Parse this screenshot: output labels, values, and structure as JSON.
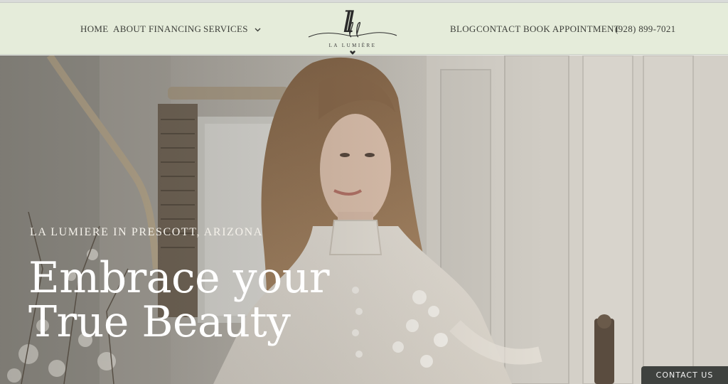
{
  "nav": {
    "home": "HOME",
    "about": "ABOUT",
    "financing": "FINANCING",
    "services": "SERVICES",
    "blog": "BLOG",
    "contact": "CONTACT",
    "book": "BOOK APPOINTMENT",
    "phone": "(928) 899-7021"
  },
  "logo": {
    "monogram": "ll",
    "name": "LA LUMIÈRE"
  },
  "hero": {
    "eyebrow": "LA LUMIERE IN PRESCOTT, ARIZONA",
    "headline_line1": "Embrace your",
    "headline_line2": "True Beauty"
  },
  "contact_tab": {
    "label": "CONTACT US"
  },
  "icons": {
    "services_dropdown": "chevron-down-icon",
    "logo_ornament": "heart-icon"
  },
  "colors": {
    "nav_bg": "#e5ecda",
    "nav_text": "#3d3f3a",
    "contact_tab_bg": "#3f423f",
    "headline": "#ffffff"
  }
}
